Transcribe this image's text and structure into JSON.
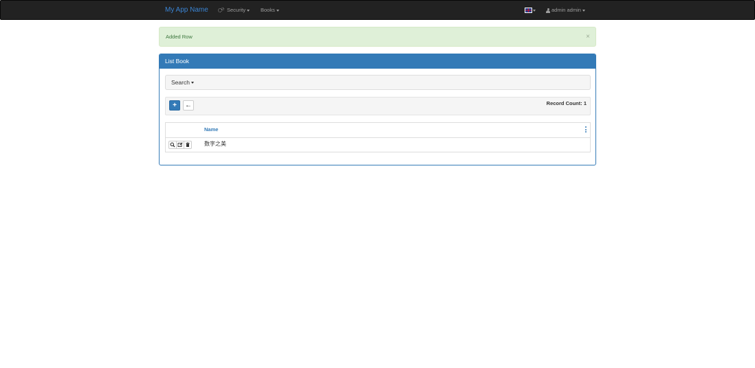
{
  "navbar": {
    "brand": "My App Name",
    "menus": [
      {
        "label": "Security",
        "icon": "gears-icon"
      },
      {
        "label": "Books"
      }
    ],
    "language_icon": "uk-flag-icon",
    "user": {
      "label": "admin admin",
      "icon": "user-icon"
    }
  },
  "alert": {
    "message": "Added Row",
    "close": "×",
    "color": "#dff0d8"
  },
  "panel": {
    "title": "List Book",
    "accent": "#337ab7",
    "search": {
      "label": "Search"
    },
    "toolbar": {
      "add_label": "+",
      "back_label": "←",
      "record_count": "Record Count: 1"
    },
    "table": {
      "columns": [
        "Name"
      ],
      "rows": [
        {
          "name": "数字之美",
          "actions": [
            "search-icon",
            "edit-icon",
            "trash-icon"
          ]
        }
      ]
    }
  }
}
